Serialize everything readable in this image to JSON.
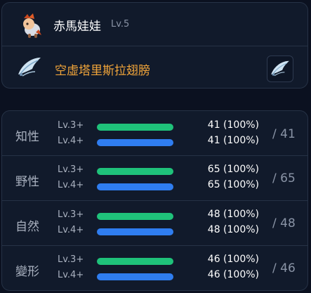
{
  "pet": {
    "name": "赤馬娃娃",
    "level": "Lv.5",
    "icon": "pony-pet-icon"
  },
  "item": {
    "name": "空虛塔里斯拉翅膀",
    "icon": "wing-icon"
  },
  "colors": {
    "accent_orange": "#f0a43a",
    "bar_green": "#1fc27a",
    "bar_blue": "#2f7df0"
  },
  "stats": [
    {
      "label": "知性",
      "total": "/ 41",
      "rows": [
        {
          "lv": "Lv.3+",
          "value": "41 (100%)",
          "fill": 1.0
        },
        {
          "lv": "Lv.4+",
          "value": "41 (100%)",
          "fill": 1.0
        }
      ]
    },
    {
      "label": "野性",
      "total": "/ 65",
      "rows": [
        {
          "lv": "Lv.3+",
          "value": "65 (100%)",
          "fill": 1.0
        },
        {
          "lv": "Lv.4+",
          "value": "65 (100%)",
          "fill": 1.0
        }
      ]
    },
    {
      "label": "自然",
      "total": "/ 48",
      "rows": [
        {
          "lv": "Lv.3+",
          "value": "48 (100%)",
          "fill": 1.0
        },
        {
          "lv": "Lv.4+",
          "value": "48 (100%)",
          "fill": 1.0
        }
      ]
    },
    {
      "label": "變形",
      "total": "/ 46",
      "rows": [
        {
          "lv": "Lv.3+",
          "value": "46 (100%)",
          "fill": 1.0
        },
        {
          "lv": "Lv.4+",
          "value": "46 (100%)",
          "fill": 1.0
        }
      ]
    }
  ]
}
